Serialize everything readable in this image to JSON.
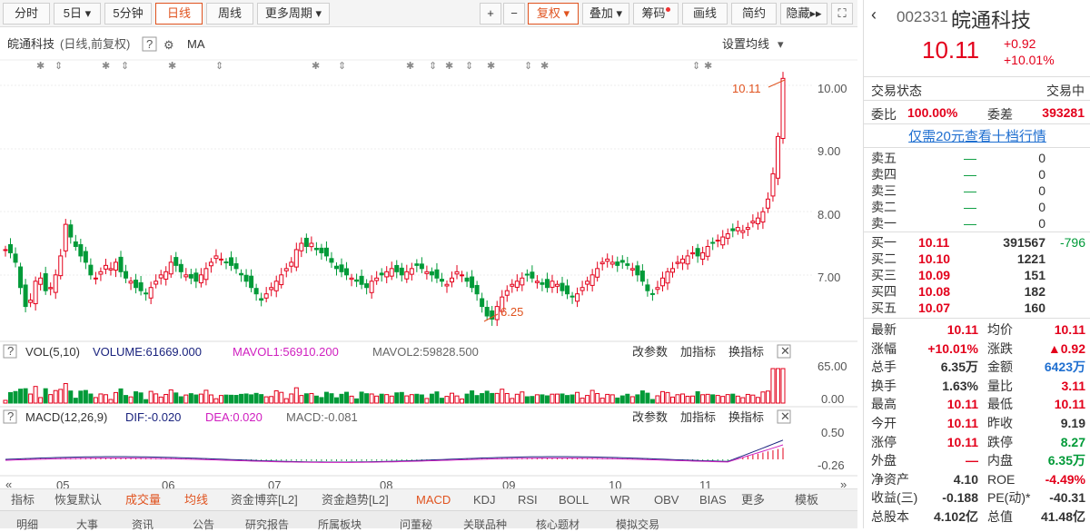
{
  "toolbar": {
    "left": [
      "分时",
      "5日",
      "5分钟",
      "日线",
      "周线",
      "更多周期"
    ],
    "right": [
      "+",
      "−",
      "复权",
      "叠加",
      "筹码",
      "画线",
      "简约",
      "隐藏"
    ]
  },
  "chart_header": {
    "name": "皖通科技",
    "mode": "(日线,前复权)",
    "ma": "MA",
    "ma_setting": "设置均线"
  },
  "price_axis": [
    "10.00",
    "9.00",
    "8.00",
    "7.00"
  ],
  "price_high_label": "10.11",
  "price_low_label": "6.25",
  "vol_header": {
    "title": "VOL(5,10)",
    "volume": "VOLUME:61669.000",
    "mavol1": "MAVOL1:56910.200",
    "mavol2": "MAVOL2:59828.500",
    "btns": [
      "改参数",
      "加指标",
      "换指标"
    ]
  },
  "vol_axis": [
    "65.00",
    "0.00"
  ],
  "macd_header": {
    "title": "MACD(12,26,9)",
    "dif": "DIF:-0.020",
    "dea": "DEA:0.020",
    "macd": "MACD:-0.081",
    "btns": [
      "改参数",
      "加指标",
      "换指标"
    ]
  },
  "macd_axis": [
    "0.50",
    "-0.26"
  ],
  "months": [
    "05",
    "06",
    "07",
    "08",
    "09",
    "10",
    "11"
  ],
  "bottom_tabs": [
    "指标",
    "恢复默认",
    "成交量",
    "均线",
    "资金博弈[L2]",
    "资金趋势[L2]",
    "MACD",
    "KDJ",
    "RSI",
    "BOLL",
    "WR",
    "OBV",
    "BIAS",
    "更多",
    "模板"
  ],
  "bottom_tabs2": [
    "明细",
    "大事",
    "资讯",
    "公告",
    "研究报告",
    "所属板块",
    "问董秘",
    "关联品种",
    "核心题材",
    "模拟交易"
  ],
  "quote": {
    "code": "002331",
    "name": "皖通科技",
    "price": "10.11",
    "change": "+0.92",
    "pct": "+10.01%",
    "status_label": "交易状态",
    "status": "交易中",
    "weibi_label": "委比",
    "weibi": "100.00%",
    "weicha_label": "委差",
    "weicha": "393281",
    "link": "仅需20元查看十档行情",
    "sells": [
      {
        "l": "卖五",
        "p": "—",
        "v": "0"
      },
      {
        "l": "卖四",
        "p": "—",
        "v": "0"
      },
      {
        "l": "卖三",
        "p": "—",
        "v": "0"
      },
      {
        "l": "卖二",
        "p": "—",
        "v": "0"
      },
      {
        "l": "卖一",
        "p": "—",
        "v": "0"
      }
    ],
    "buys": [
      {
        "l": "买一",
        "p": "10.11",
        "v": "391567",
        "d": "-796"
      },
      {
        "l": "买二",
        "p": "10.10",
        "v": "1221",
        "d": ""
      },
      {
        "l": "买三",
        "p": "10.09",
        "v": "151",
        "d": ""
      },
      {
        "l": "买四",
        "p": "10.08",
        "v": "182",
        "d": ""
      },
      {
        "l": "买五",
        "p": "10.07",
        "v": "160",
        "d": ""
      }
    ],
    "stats": [
      {
        "a": "最新",
        "av": "10.11",
        "ac": "red",
        "b": "均价",
        "bv": "10.11",
        "bc": "red"
      },
      {
        "a": "涨幅",
        "av": "+10.01%",
        "ac": "red",
        "b": "涨跌",
        "bv": "▲0.92",
        "bc": "red"
      },
      {
        "a": "总手",
        "av": "6.35万",
        "ac": "",
        "b": "金额",
        "bv": "6423万",
        "bc": "blue"
      },
      {
        "a": "换手",
        "av": "1.63%",
        "ac": "",
        "b": "量比",
        "bv": "3.11",
        "bc": "red"
      },
      {
        "a": "最高",
        "av": "10.11",
        "ac": "red",
        "b": "最低",
        "bv": "10.11",
        "bc": "red"
      },
      {
        "a": "今开",
        "av": "10.11",
        "ac": "red",
        "b": "昨收",
        "bv": "9.19",
        "bc": ""
      },
      {
        "a": "涨停",
        "av": "10.11",
        "ac": "red",
        "b": "跌停",
        "bv": "8.27",
        "bc": "green"
      },
      {
        "a": "外盘",
        "av": "—",
        "ac": "red",
        "b": "内盘",
        "bv": "6.35万",
        "bc": "green"
      },
      {
        "a": "净资产",
        "av": "4.10",
        "ac": "",
        "b": "ROE",
        "bv": "-4.49%",
        "bc": "red"
      },
      {
        "a": "收益(三)",
        "av": "-0.188",
        "ac": "",
        "b": "PE(动)*",
        "bv": "-40.31",
        "bc": ""
      },
      {
        "a": "总股本",
        "av": "4.102亿",
        "ac": "",
        "b": "总值",
        "bv": "41.48亿",
        "bc": ""
      }
    ]
  },
  "colors": {
    "up": "#e3001b",
    "down": "#009a38",
    "accent": "#e0531f"
  },
  "chart_data": {
    "type": "candlestick",
    "ylim": [
      6.0,
      10.5
    ],
    "closes": [
      7.4,
      7.35,
      7.2,
      6.8,
      6.5,
      6.6,
      6.9,
      6.95,
      6.75,
      6.8,
      7.0,
      7.3,
      7.8,
      7.6,
      7.45,
      7.3,
      7.2,
      7.0,
      6.95,
      7.05,
      7.15,
      7.1,
      7.2,
      7.05,
      6.95,
      6.9,
      6.8,
      6.75,
      6.7,
      6.8,
      6.9,
      7.0,
      7.05,
      7.2,
      7.15,
      7.05,
      7.0,
      6.95,
      6.9,
      7.0,
      7.1,
      7.2,
      7.3,
      7.25,
      7.2,
      7.15,
      7.1,
      7.0,
      6.9,
      6.8,
      6.7,
      6.6,
      6.7,
      6.8,
      6.9,
      7.0,
      7.1,
      7.2,
      7.4,
      7.5,
      7.45,
      7.5,
      7.4,
      7.35,
      7.3,
      7.2,
      7.1,
      7.05,
      7.0,
      6.95,
      6.9,
      6.85,
      6.8,
      6.9,
      6.95,
      7.0,
      7.05,
      7.1,
      7.05,
      7.0,
      7.05,
      7.1,
      7.15,
      7.1,
      7.05,
      7.0,
      6.95,
      6.9,
      6.85,
      6.95,
      7.05,
      7.0,
      6.9,
      6.8,
      6.7,
      6.5,
      6.35,
      6.3,
      6.5,
      6.65,
      6.75,
      6.85,
      6.9,
      6.95,
      7.0,
      6.95,
      6.9,
      6.85,
      6.8,
      6.9,
      6.85,
      6.75,
      6.7,
      6.65,
      6.7,
      6.8,
      6.9,
      7.0,
      7.1,
      7.2,
      7.25,
      7.2,
      7.15,
      7.2,
      7.15,
      7.1,
      7.0,
      6.9,
      6.75,
      6.7,
      6.8,
      6.95,
      7.05,
      7.1,
      7.2,
      7.25,
      7.3,
      7.35,
      7.3,
      7.35,
      7.45,
      7.5,
      7.55,
      7.6,
      7.65,
      7.7,
      7.75,
      7.7,
      7.75,
      7.85,
      7.9,
      8.0,
      8.2,
      8.6,
      9.19,
      10.11
    ]
  }
}
